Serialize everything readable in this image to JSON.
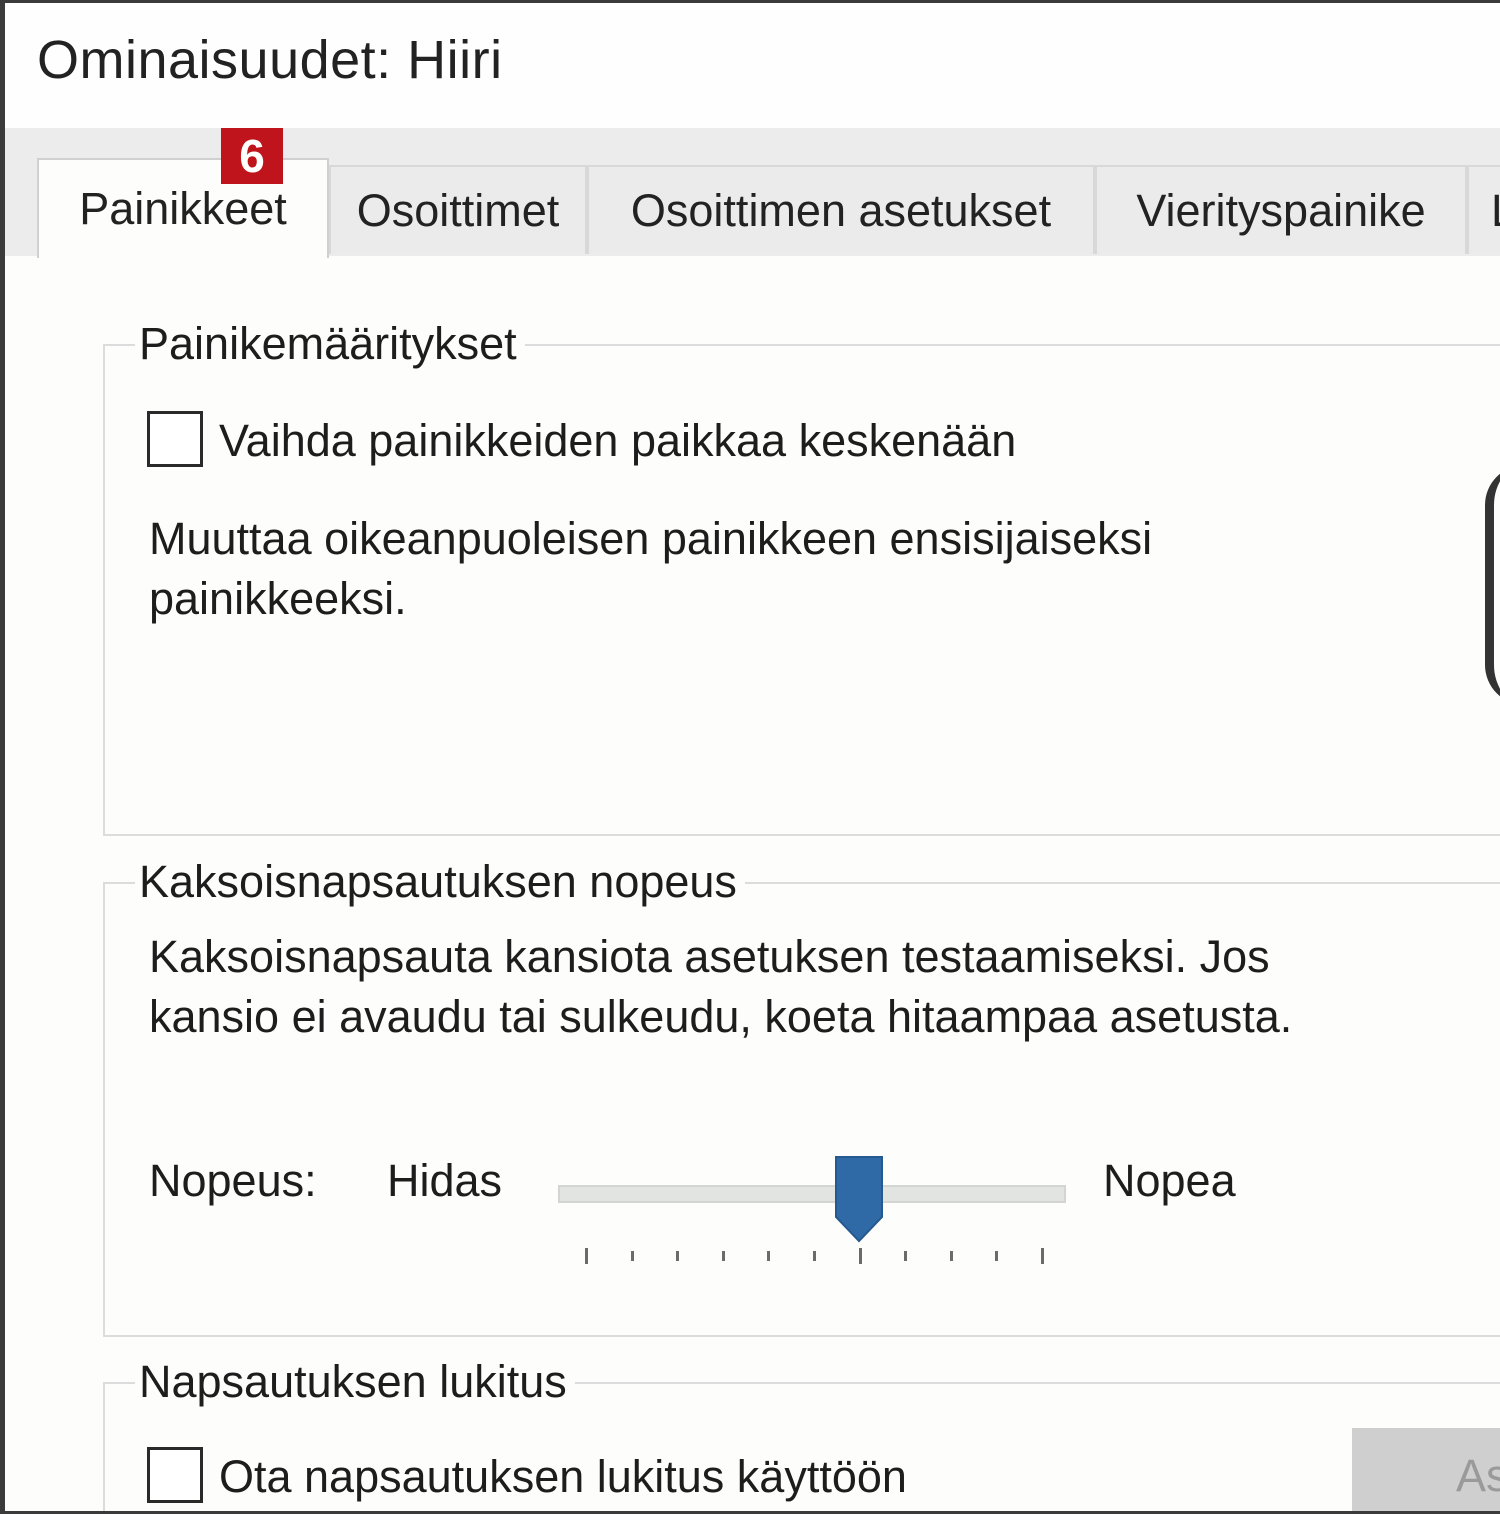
{
  "window": {
    "title": "Ominaisuudet: Hiiri"
  },
  "annotation_badge": "6",
  "tabs": [
    {
      "label": "Painikkeet",
      "active": true
    },
    {
      "label": "Osoittimet",
      "active": false
    },
    {
      "label": "Osoittimen asetukset",
      "active": false
    },
    {
      "label": "Vierityspainike",
      "active": false
    },
    {
      "label": "L",
      "active": false
    }
  ],
  "button_config": {
    "legend": "Painikemääritykset",
    "checkbox_label": "Vaihda painikkeiden paikkaa keskenään",
    "checked": false,
    "description_line1": "Muuttaa oikeanpuoleisen painikkeen ensisijaiseksi",
    "description_line2": "painikkeeksi."
  },
  "double_click": {
    "legend": "Kaksoisnapsautuksen nopeus",
    "description_line1": "Kaksoisnapsauta kansiota asetuksen testaamiseksi. Jos",
    "description_line2": "kansio ei avaudu tai sulkeudu, koeta hitaampaa asetusta.",
    "speed_label": "Nopeus:",
    "slow_label": "Hidas",
    "fast_label": "Nopea",
    "slider_value": 0.6,
    "tick_count": 11,
    "accent_color": "#2f6aa6"
  },
  "click_lock": {
    "legend": "Napsautuksen lukitus",
    "checkbox_label": "Ota napsautuksen lukitus käyttöön",
    "checked": false,
    "settings_button_label": "As"
  }
}
